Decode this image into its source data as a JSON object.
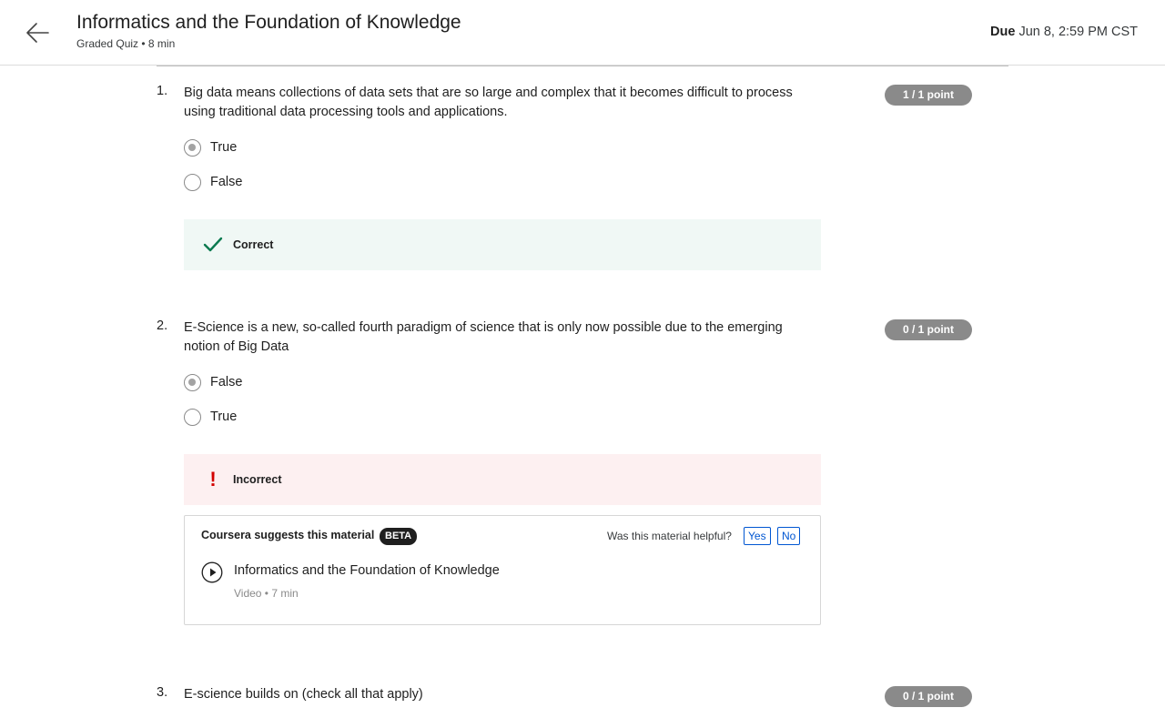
{
  "header": {
    "title": "Informatics and the Foundation of Knowledge",
    "subtitle": "Graded Quiz • 8 min",
    "due_label": "Due",
    "due_value": "Jun 8, 2:59 PM CST"
  },
  "questions": [
    {
      "number": "1.",
      "text": "Big data means collections of data sets that are so large and complex that it becomes difficult to process using traditional data processing tools and applications.",
      "points": "1 / 1 point",
      "options": [
        {
          "label": "True",
          "selected": true
        },
        {
          "label": "False",
          "selected": false
        }
      ],
      "feedback": {
        "status": "correct",
        "label": "Correct"
      }
    },
    {
      "number": "2.",
      "text": "E-Science is a new, so-called fourth paradigm of science that is only now possible due to the emerging notion of Big Data",
      "points": "0 / 1 point",
      "options": [
        {
          "label": "False",
          "selected": true
        },
        {
          "label": "True",
          "selected": false
        }
      ],
      "feedback": {
        "status": "incorrect",
        "label": "Incorrect"
      },
      "suggestion": {
        "heading": "Coursera suggests this material",
        "badge": "BETA",
        "helpful_prompt": "Was this material helpful?",
        "yes_label": "Yes",
        "no_label": "No",
        "material_title": "Informatics and the Foundation of Knowledge",
        "material_meta": "Video • 7 min"
      }
    },
    {
      "number": "3.",
      "text": "E-science builds on (check all that apply)",
      "points": "0 / 1 point"
    }
  ],
  "colors": {
    "points_badge": "#8a8a8a",
    "correct_bg": "#f0f8f5",
    "correct_icon": "#0a7a4f",
    "incorrect_bg": "#fdf0f1",
    "incorrect_icon": "#d30000",
    "link": "#0056d2"
  }
}
